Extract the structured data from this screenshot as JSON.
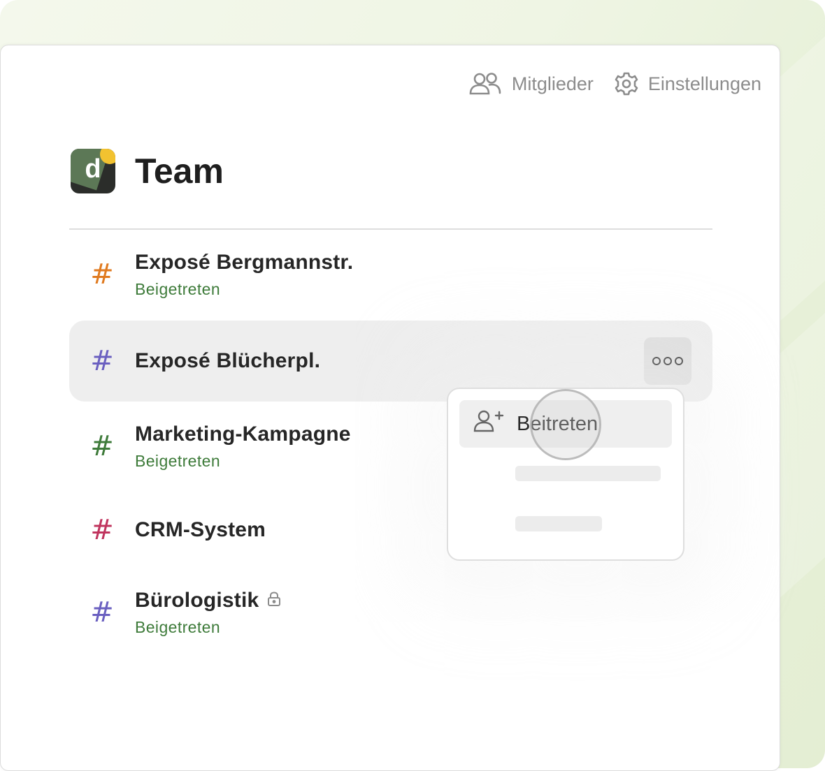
{
  "header": {
    "members_label": "Mitglieder",
    "members_icon": "users-icon",
    "settings_label": "Einstellungen",
    "settings_icon": "gear-icon"
  },
  "workspace": {
    "logo_letter": "d",
    "title": "Team"
  },
  "channels": [
    {
      "name": "Exposé Bergmannstr.",
      "status": "Beigetreten",
      "hash_color": "#e07a1f",
      "locked": false
    },
    {
      "name": "Exposé Blücherpl.",
      "status": "",
      "hash_color": "#6a5fc0",
      "locked": false,
      "selected": true
    },
    {
      "name": "Marketing-Kampagne",
      "status": "Beigetreten",
      "hash_color": "#3e7b3a",
      "locked": false
    },
    {
      "name": "CRM-System",
      "status": "",
      "hash_color": "#c0345e",
      "locked": false
    },
    {
      "name": "Bürologistik",
      "status": "Beigetreten",
      "hash_color": "#6a5fc0",
      "locked": true
    }
  ],
  "context_menu": {
    "items": [
      {
        "label": "Beitreten",
        "icon": "user-plus-icon"
      }
    ]
  },
  "colors": {
    "status_green": "#3e7b3a",
    "selected_row_bg": "#eeeeee",
    "muted_text": "#8c8c8c"
  }
}
